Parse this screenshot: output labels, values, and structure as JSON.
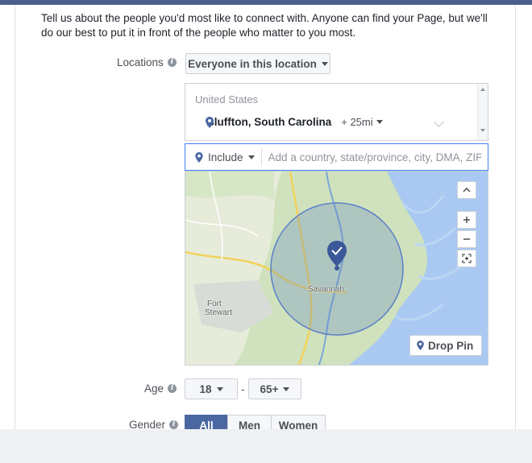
{
  "intro_text": "Tell us about the people you'd most like to connect with. Anyone can find your Page, but we'll do our best to put it in front of the people who matter to you most.",
  "locations": {
    "label": "Locations",
    "mode_selected": "Everyone in this location",
    "country": "United States",
    "items": [
      {
        "name": "Bluffton, South Carolina",
        "radius": "+ 25mi"
      }
    ],
    "include_label": "Include",
    "search_placeholder": "Add a country, state/province, city, DMA, ZIP"
  },
  "map": {
    "city_labels": [
      "Savannah",
      "Fort",
      "Stewart"
    ],
    "drop_pin_label": "Drop Pin",
    "colors": {
      "water": "#a9c9f2",
      "land": "#e6ecd9",
      "forest": "#cfe2bd",
      "radius": "#5b7fc7",
      "pin": "#3b5998"
    }
  },
  "age": {
    "label": "Age",
    "min_selected": "18",
    "separator": "-",
    "max_selected": "65+"
  },
  "gender": {
    "label": "Gender",
    "options": [
      "All",
      "Men",
      "Women"
    ],
    "selected": "All"
  },
  "colors": {
    "accent": "#4b67a1",
    "focus_border": "#4080ff"
  }
}
